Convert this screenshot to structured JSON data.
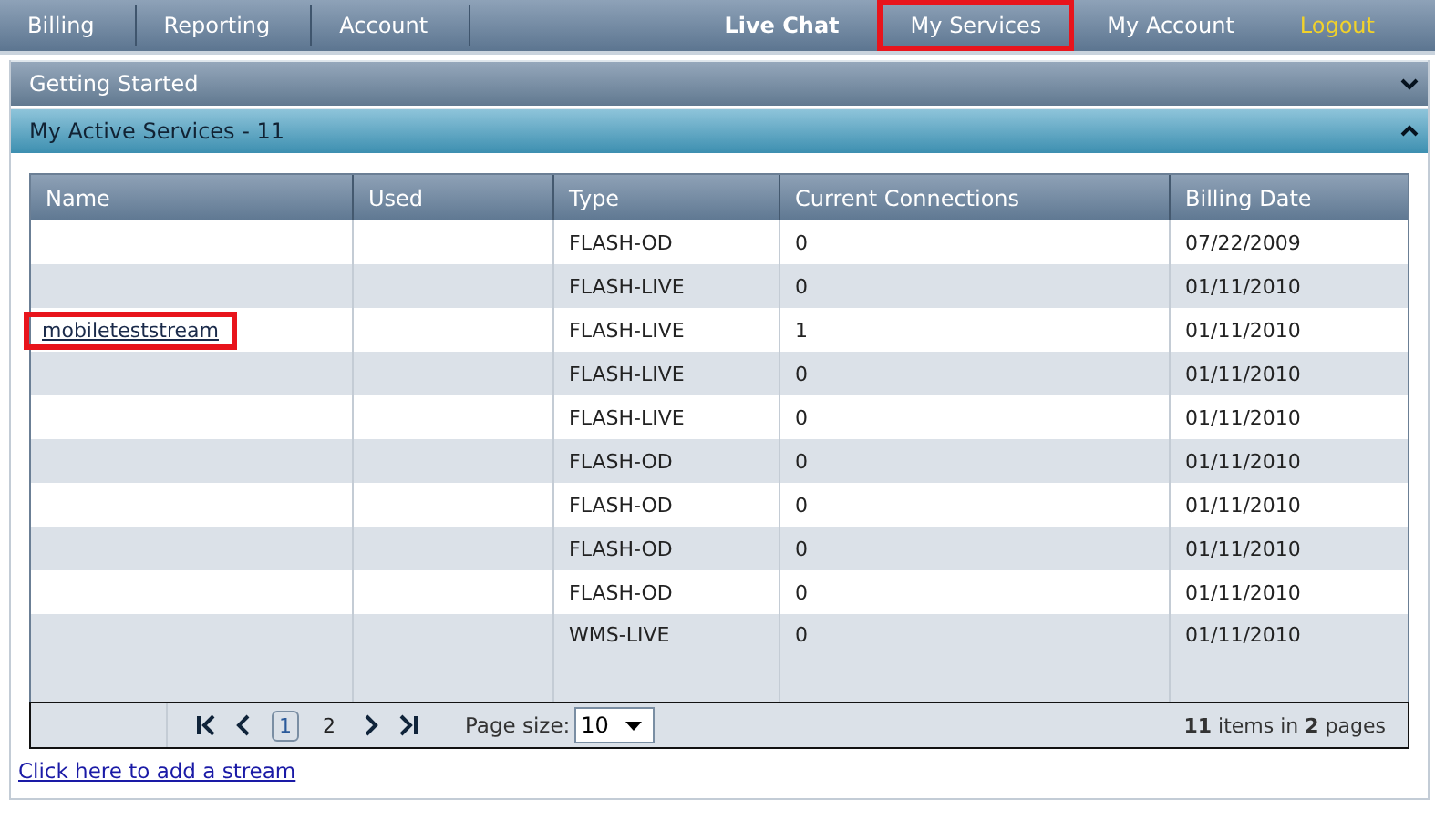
{
  "nav": {
    "left": [
      {
        "label": "Billing"
      },
      {
        "label": "Reporting"
      },
      {
        "label": "Account"
      }
    ],
    "right": [
      {
        "label": "Live Chat",
        "kind": "bold",
        "highlighted": false
      },
      {
        "label": "My Services",
        "kind": "plain",
        "highlighted": true
      },
      {
        "label": "My Account",
        "kind": "plain",
        "highlighted": false
      },
      {
        "label": "Logout",
        "kind": "logout",
        "highlighted": false
      }
    ]
  },
  "panels": [
    {
      "title": "Getting Started",
      "expanded": false
    },
    {
      "title": "My Active Services - 11",
      "expanded": true
    }
  ],
  "table": {
    "columns": [
      "Name",
      "Used",
      "Type",
      "Current Connections",
      "Billing Date"
    ],
    "rows": [
      {
        "type": "FLASH-OD",
        "connections": "0",
        "billing_date": "07/22/2009"
      },
      {
        "type": "FLASH-LIVE",
        "connections": "0",
        "billing_date": "01/11/2010"
      },
      {
        "name": "mobileteststream",
        "name_highlighted": true,
        "type": "FLASH-LIVE",
        "connections": "1",
        "billing_date": "01/11/2010"
      },
      {
        "type": "FLASH-LIVE",
        "connections": "0",
        "billing_date": "01/11/2010"
      },
      {
        "type": "FLASH-LIVE",
        "connections": "0",
        "billing_date": "01/11/2010"
      },
      {
        "type": "FLASH-OD",
        "connections": "0",
        "billing_date": "01/11/2010"
      },
      {
        "type": "FLASH-OD",
        "connections": "0",
        "billing_date": "01/11/2010"
      },
      {
        "type": "FLASH-OD",
        "connections": "0",
        "billing_date": "01/11/2010"
      },
      {
        "type": "FLASH-OD",
        "connections": "0",
        "billing_date": "01/11/2010"
      },
      {
        "type": "WMS-LIVE",
        "connections": "0",
        "billing_date": "01/11/2010"
      }
    ],
    "pager": {
      "pages": [
        {
          "label": "1",
          "selected": true
        },
        {
          "label": "2",
          "selected": false
        }
      ],
      "page_size_label": "Page size:",
      "page_size": "10",
      "summary": "**11** items in **2** pages"
    }
  },
  "add_link": "Click here to add a stream"
}
